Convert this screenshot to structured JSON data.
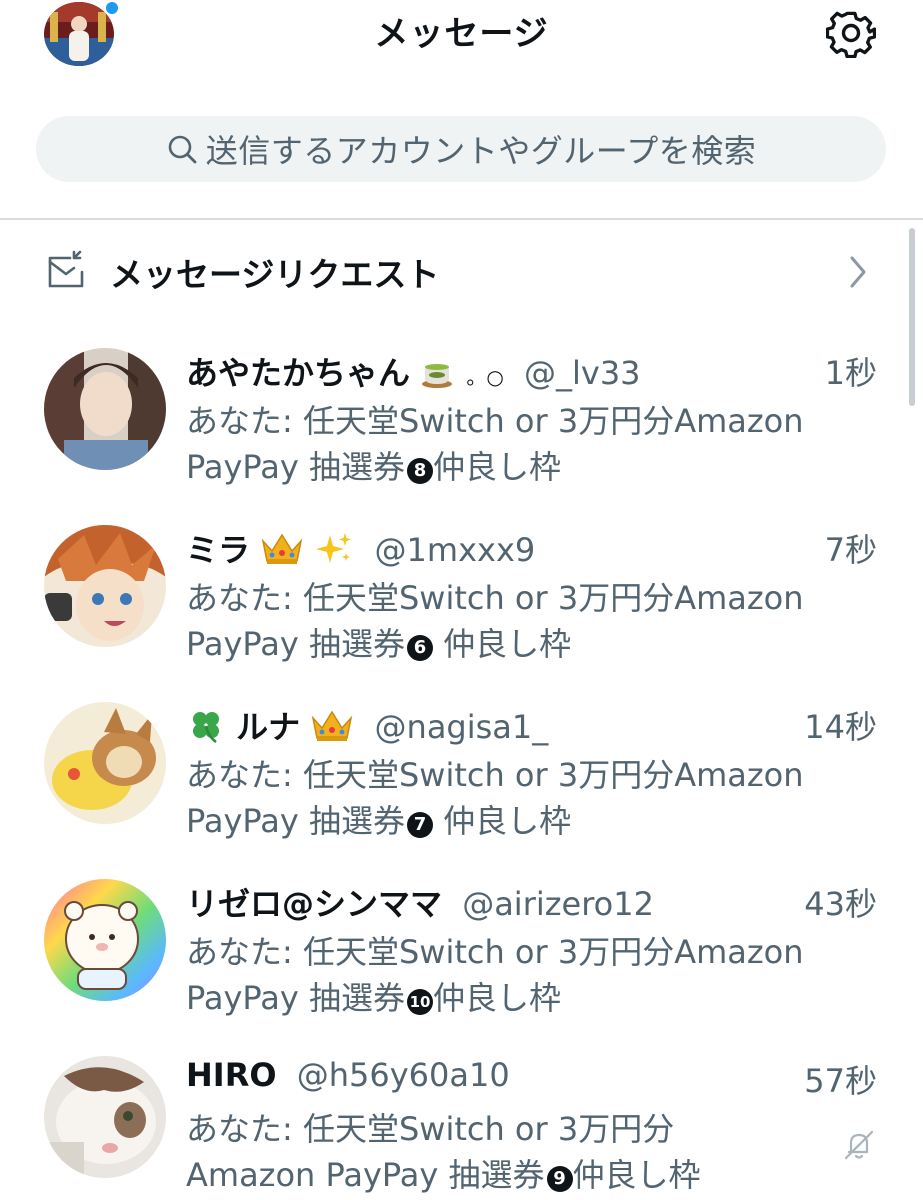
{
  "header": {
    "title": "メッセージ"
  },
  "search": {
    "placeholder": "送信するアカウントやグループを検索"
  },
  "requests": {
    "label": "メッセージリクエスト"
  },
  "conversations": [
    {
      "name": "あやたかちゃん",
      "name_suffix": "。○",
      "handle": "@_lv33",
      "time": "1秒",
      "line2": "あなた: 任天堂Switch or 3万円分Amazon",
      "line3_pre": "PayPay  抽選券",
      "number": "8",
      "line3_post": "仲良し枠",
      "icons": [
        "tea-emoji"
      ]
    },
    {
      "name": "ミラ",
      "name_suffix": "",
      "handle": "@1mxxx9",
      "time": "7秒",
      "line2": "あなた: 任天堂Switch or 3万円分Amazon",
      "line3_pre": "PayPay  抽選券",
      "number": "6",
      "line3_post": " 仲良し枠",
      "icons": [
        "crown-emoji",
        "sparkles-emoji"
      ]
    },
    {
      "name": "ルナ",
      "name_suffix": "",
      "handle": "@nagisa1_",
      "time": "14秒",
      "line2": "あなた: 任天堂Switch or 3万円分Amazon",
      "line3_pre": "PayPay  抽選券",
      "number": "7",
      "line3_post": " 仲良し枠",
      "icons": [
        "clover-emoji",
        "crown-emoji"
      ]
    },
    {
      "name": "リゼロ@シンママ",
      "name_suffix": "",
      "handle": "@airizero12",
      "time": "43秒",
      "line2": "あなた: 任天堂Switch or 3万円分Amazon",
      "line3_pre": "PayPay  抽選券",
      "number": "10",
      "line3_post": "仲良し枠",
      "icons": []
    },
    {
      "name": "HIRO",
      "name_suffix": "",
      "handle": "@h56y60a10",
      "time": "57秒",
      "line2": "あなた: 任天堂Switch or 3万円分",
      "line3_pre": "Amazon PayPay  抽選券",
      "number": "9",
      "line3_post": "仲良し枠",
      "icons": [
        "muted-bell-icon"
      ]
    }
  ],
  "colors": {
    "text_primary": "#0f1419",
    "text_secondary": "#536471",
    "search_bg": "#eff3f4",
    "accent": "#1d9bf0"
  }
}
